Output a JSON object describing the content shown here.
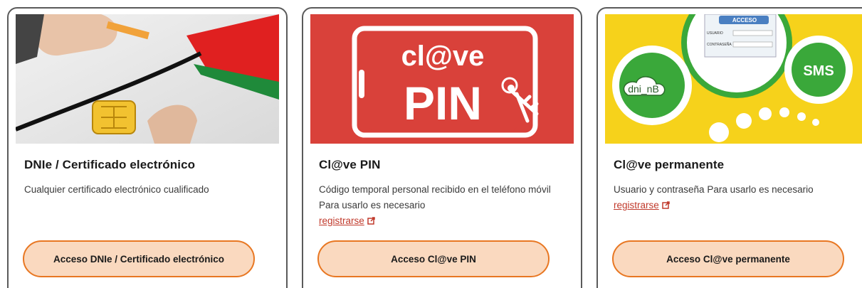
{
  "cards": [
    {
      "title": "DNIe / Certificado electrónico",
      "description": "Cualquier certificado electrónico cualificado",
      "button_label": "Acceso DNIe / Certificado electrónico"
    },
    {
      "title": "Cl@ve PIN",
      "description": "Código temporal personal recibido en el teléfono móvil Para usarlo es necesario",
      "link_label": "registrarse",
      "button_label": "Acceso Cl@ve PIN",
      "image_text": {
        "top": "cl@ve",
        "bottom": "PIN"
      }
    },
    {
      "title": "Cl@ve permanente",
      "description": "Usuario y contraseña Para usarlo es necesario",
      "link_label": "registrarse",
      "button_label": "Acceso Cl@ve permanente",
      "image_text": {
        "form_title": "ACCESO",
        "user_label": "USUARIO",
        "password_label": "CONTRASEÑA",
        "left_bubble": "dni_nB",
        "right_bubble": "SMS"
      }
    }
  ],
  "colors": {
    "accent": "#e87722",
    "button_fill": "#fad9bf",
    "link": "#c0392b",
    "clave_red": "#d9413a",
    "clave_yellow": "#f6d21b",
    "clave_green": "#3aa83a"
  },
  "icons": [
    "external-link-icon",
    "keys-icon",
    "chip-icon",
    "cloud-icon"
  ]
}
